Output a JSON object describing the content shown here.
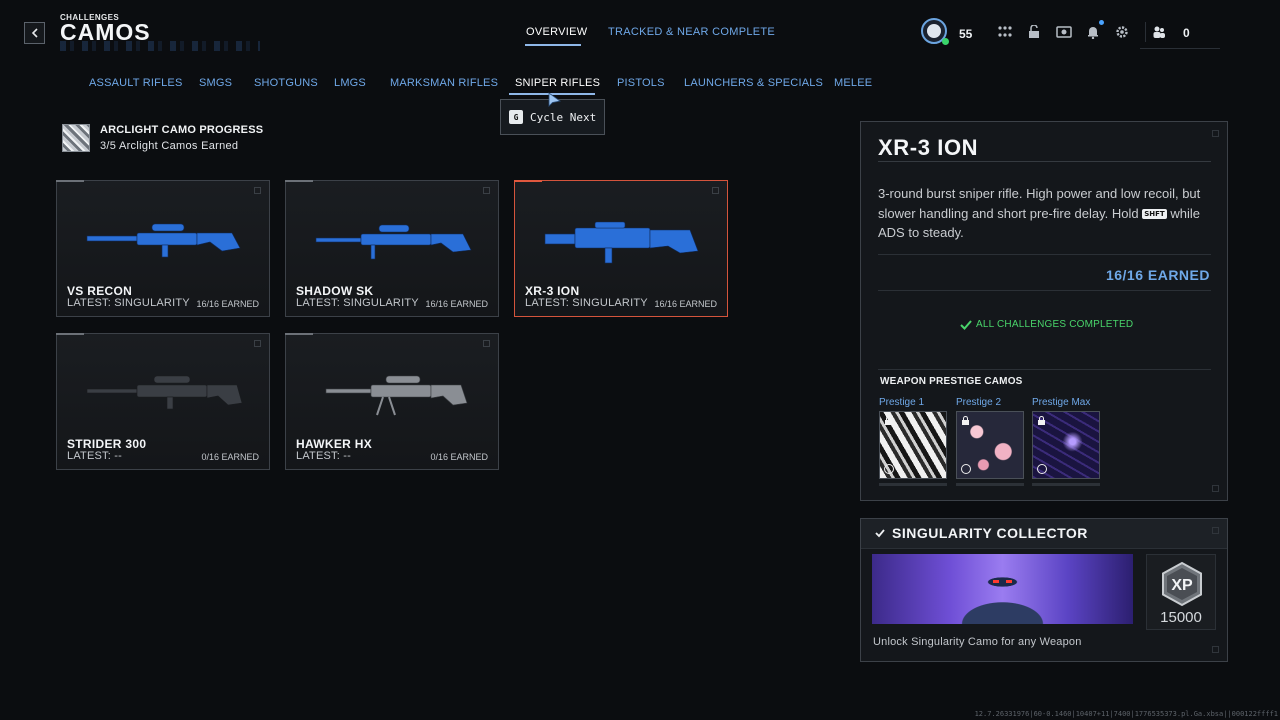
{
  "header": {
    "breadcrumb": "CHALLENGES",
    "title": "CAMOS",
    "tabs": [
      {
        "label": "OVERVIEW",
        "active": true
      },
      {
        "label": "TRACKED & NEAR COMPLETE",
        "active": false
      }
    ],
    "level": "55",
    "party_count": "0",
    "icons": [
      "level-badge-icon",
      "grid-icon",
      "unlock-icon",
      "crate-icon",
      "bell-icon",
      "settings-gear-icon",
      "party-icon"
    ]
  },
  "categories": [
    {
      "label": "ASSAULT RIFLES",
      "active": false
    },
    {
      "label": "SMGS",
      "active": false
    },
    {
      "label": "SHOTGUNS",
      "active": false
    },
    {
      "label": "LMGS",
      "active": false
    },
    {
      "label": "MARKSMAN RIFLES",
      "active": false
    },
    {
      "label": "SNIPER RIFLES",
      "active": true
    },
    {
      "label": "PISTOLS",
      "active": false
    },
    {
      "label": "LAUNCHERS & SPECIALS",
      "active": false
    },
    {
      "label": "MELEE",
      "active": false
    }
  ],
  "tooltip": {
    "key": "G",
    "text": "Cycle Next"
  },
  "progress": {
    "title": "ARCLIGHT CAMO PROGRESS",
    "subtitle": "3/5 Arclight Camos Earned"
  },
  "weapons": [
    {
      "name": "VS RECON",
      "latest": "LATEST: SINGULARITY",
      "earned": "16/16 EARNED",
      "selected": false,
      "camo": "#2a6fd8"
    },
    {
      "name": "SHADOW SK",
      "latest": "LATEST: SINGULARITY",
      "earned": "16/16 EARNED",
      "selected": false,
      "camo": "#2a6fd8"
    },
    {
      "name": "XR-3 ION",
      "latest": "LATEST: SINGULARITY",
      "earned": "16/16 EARNED",
      "selected": true,
      "camo": "#2a6fd8"
    },
    {
      "name": "STRIDER 300",
      "latest": "LATEST: --",
      "earned": "0/16 EARNED",
      "selected": false,
      "camo": "#3a3e44"
    },
    {
      "name": "HAWKER HX",
      "latest": "LATEST: --",
      "earned": "0/16 EARNED",
      "selected": false,
      "camo": "#6a6e74"
    }
  ],
  "detail": {
    "name": "XR-3 ION",
    "desc_1": "3-round burst sniper rifle. High power and low recoil, but slower handling and short pre-fire delay. Hold",
    "desc_key": "SHFT",
    "desc_2": "while ADS to steady.",
    "earned": "16/16 EARNED",
    "status": "ALL CHALLENGES COMPLETED",
    "prestige_title": "WEAPON PRESTIGE CAMOS",
    "prestige": [
      {
        "label": "Prestige 1"
      },
      {
        "label": "Prestige 2"
      },
      {
        "label": "Prestige Max"
      }
    ]
  },
  "reward": {
    "title": "SINGULARITY COLLECTOR",
    "xp_label": "XP",
    "xp_value": "15000",
    "desc": "Unlock Singularity Camo for any Weapon"
  },
  "footer_debug": "12.7.26331976|60-0.1460|10407+11|7400|1776535373.pl.Ga.xbsa||000122ffff1",
  "colors": {
    "accent_blue": "#6fa8e8",
    "selected_border": "#d4543c",
    "complete_green": "#49d46a"
  }
}
